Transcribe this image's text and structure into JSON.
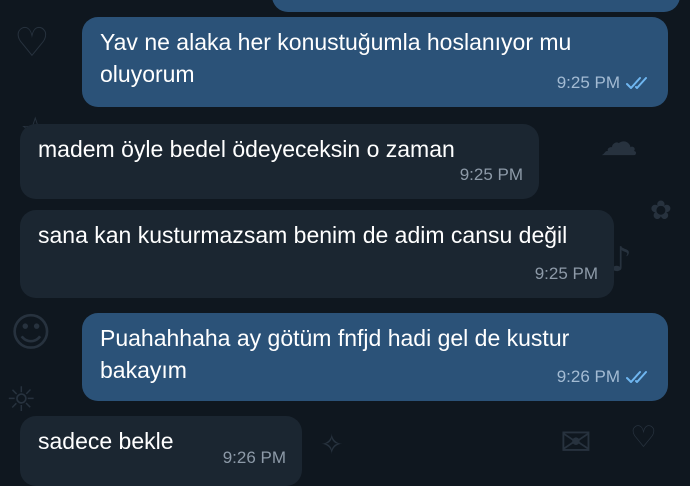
{
  "chat": {
    "messages": [
      {
        "direction": "out",
        "text": "Yav ne alaka her konustuğumla hoslanıyor mu oluyorum",
        "time": "9:25 PM",
        "status_icon": "double-check-icon"
      },
      {
        "direction": "in",
        "text": "madem öyle bedel ödeyeceksin o zaman",
        "time": "9:25 PM"
      },
      {
        "direction": "in",
        "text": "sana kan kusturmazsam benim de adim cansu değil",
        "time": "9:25 PM"
      },
      {
        "direction": "out",
        "text": "Puahahhaha ay götüm fnfjd hadi gel de kustur bakayım",
        "time": "9:26 PM",
        "status_icon": "double-check-icon"
      },
      {
        "direction": "in",
        "text": "sadece bekle",
        "time": "9:26 PM"
      }
    ]
  },
  "colors": {
    "background": "#0f171f",
    "outgoing_bubble": "#2b5278",
    "incoming_bubble": "#1b2631",
    "read_ticks": "#6fb6f0"
  }
}
